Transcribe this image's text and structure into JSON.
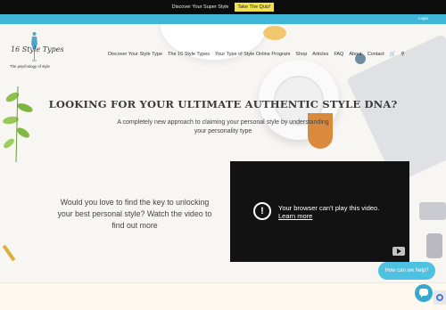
{
  "promo": {
    "text": "Discover Your Super Style",
    "button_label": "Take The Quiz!"
  },
  "topbar": {
    "login_label": "Login"
  },
  "logo": {
    "title": "16 Style Types",
    "tagline": "The psychology of style"
  },
  "nav": {
    "items": [
      {
        "label": "Discover Your Style Type"
      },
      {
        "label": "The 16 Style Types"
      },
      {
        "label": "Your Type of Style Online Program"
      },
      {
        "label": "Shop"
      },
      {
        "label": "Articles"
      },
      {
        "label": "FAQ"
      },
      {
        "label": "About"
      },
      {
        "label": "Contact"
      }
    ],
    "cart_icon": "cart-icon",
    "search_icon": "search-icon"
  },
  "hero": {
    "headline": "LOOKING FOR YOUR ULTIMATE AUTHENTIC STYLE DNA?",
    "subhead": "A completely new approach to claiming your personal style by understanding your personality type",
    "question": "Would you love to find the key to unlocking your best personal style? Watch the video to find out more"
  },
  "video": {
    "message": "Your browser can't play this video.",
    "link_label": "Learn more",
    "warning_icon": "warning-icon",
    "youtube_icon": "youtube-icon"
  },
  "chat": {
    "bubble_text": "How can we help?",
    "button_icon": "chat-icon"
  },
  "colors": {
    "promo_bg": "#0c0c0c",
    "quiz_button": "#f0e04c",
    "top_bar": "#3fb5d8",
    "chat": "#4fc1e0"
  }
}
